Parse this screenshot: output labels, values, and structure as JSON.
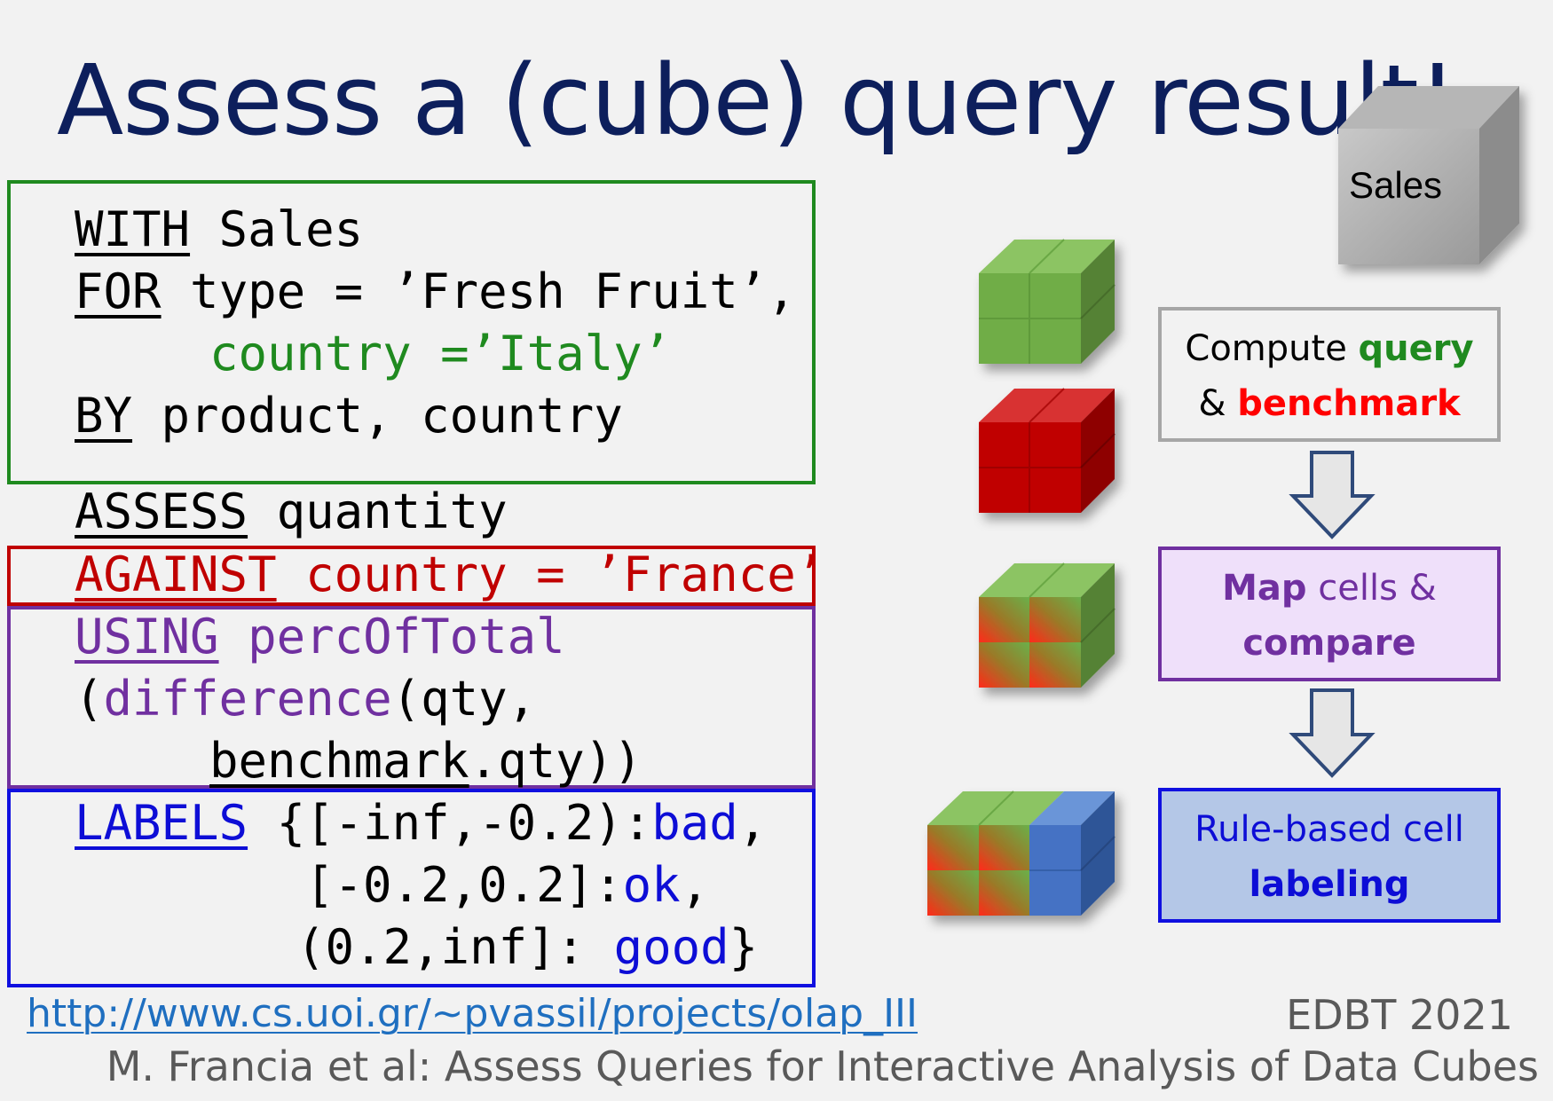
{
  "title": "Assess a (cube) query result!",
  "code": {
    "with_kw": "WITH",
    "with_rest": " Sales",
    "for_kw": "FOR",
    "for_rest": " type = ’Fresh Fruit’,",
    "country_line": "country =’Italy’",
    "by_kw": "BY",
    "by_rest": " product, country",
    "assess_kw": "ASSESS",
    "assess_rest": " quantity",
    "against_kw": "AGAINST",
    "against_rest": " country = ’France’",
    "using_kw": "USING",
    "using_rest": " percOfTotal",
    "paren_open": "(",
    "difference_fn": "difference",
    "difference_rest": "(qty,",
    "benchmark_kw": "benchmark",
    "benchmark_rest": ".qty))",
    "labels_kw": "LABELS",
    "labels_rest": " {[-inf,-0.2):",
    "label_bad": "bad",
    "comma": ",",
    "range_ok": "[-0.2,0.2]:",
    "label_ok": "ok",
    "range_good": "(0.2,inf]: ",
    "label_good": "good",
    "close_brace": "}"
  },
  "cube_label": "Sales",
  "flow": {
    "compute_prefix": "Compute ",
    "compute_query": "query",
    "compute_amp": "& ",
    "compute_benchmark": "benchmark",
    "map_bold": "Map",
    "map_rest": " cells &",
    "compare": "compare",
    "rule_line": "Rule-based cell",
    "labeling": "labeling"
  },
  "footer": {
    "link": "http://www.cs.uoi.gr/~pvassil/projects/olap_III",
    "venue": "EDBT 2021",
    "citation": "M. Francia et al: Assess Queries for Interactive Analysis of Data Cubes"
  },
  "colors": {
    "title": "#0d1f5c",
    "green": "#1f8a1f",
    "red": "#c00000",
    "purple": "#7030a0",
    "blue": "#0d0dd6"
  }
}
